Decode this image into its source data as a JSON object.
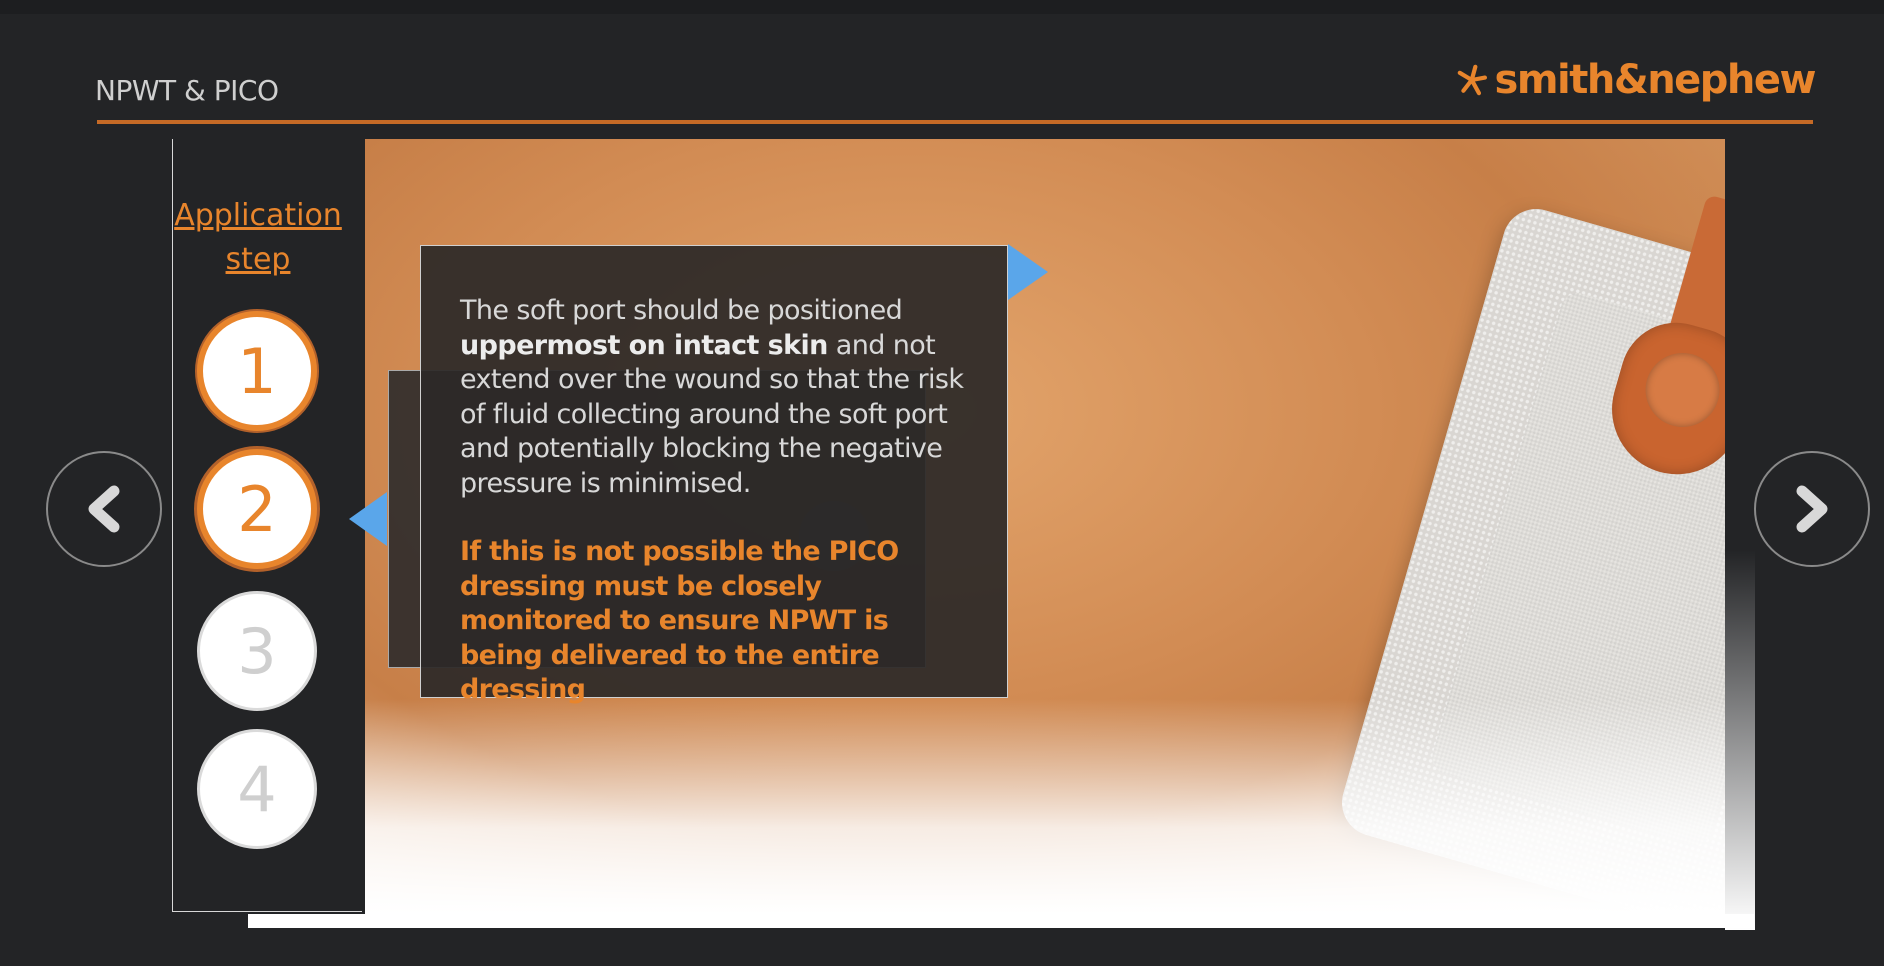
{
  "header": {
    "course_title": "NPWT & PICO",
    "brand_name": "smith&nephew",
    "brand_color": "#e8852c"
  },
  "steps": {
    "title_line1": "Application",
    "title_line2": "step",
    "items": [
      {
        "label": "1",
        "state": "done"
      },
      {
        "label": "2",
        "state": "current"
      },
      {
        "label": "3",
        "state": "todo"
      },
      {
        "label": "4",
        "state": "todo"
      }
    ]
  },
  "card": {
    "part1": "The soft port should be positioned ",
    "bold": "uppermost on intact skin",
    "part2": " and not extend over the wound so that the risk of fluid collecting around the soft port and potentially blocking the negative pressure is minimised.",
    "warning": "If this is not possible the PICO dressing must be closely monitored to ensure NPWT is being delivered to the entire dressing"
  },
  "nav": {
    "prev_icon": "chevron-left-icon",
    "next_icon": "chevron-right-icon"
  },
  "colors": {
    "accent": "#e8852c",
    "pointer": "#5aa6ea",
    "background": "#232426"
  }
}
